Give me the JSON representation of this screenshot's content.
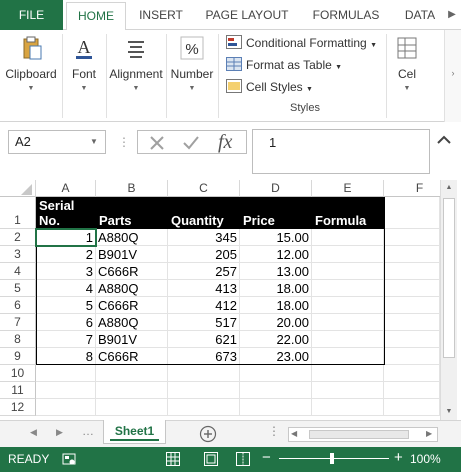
{
  "ribbon_tabs": {
    "file": "FILE",
    "home": "HOME",
    "insert": "INSERT",
    "page_layout": "PAGE LAYOUT",
    "formulas": "FORMULAS",
    "data": "DATA"
  },
  "ribbon": {
    "clipboard": "Clipboard",
    "font": "Font",
    "alignment": "Alignment",
    "number": "Number",
    "conditional_formatting": "Conditional Formatting",
    "format_as_table": "Format as Table",
    "cell_styles": "Cell Styles",
    "styles_group": "Styles",
    "cells_partial": "Cel"
  },
  "formula_bar": {
    "name_box": "A2",
    "formula": "1",
    "fx": "fx"
  },
  "grid": {
    "columns": [
      "A",
      "B",
      "C",
      "D",
      "E",
      "F"
    ],
    "rows": [
      "1",
      "2",
      "3",
      "4",
      "5",
      "6",
      "7",
      "8",
      "9",
      "10",
      "11",
      "12"
    ],
    "header": {
      "a_line1": "Serial",
      "a_line2": "No.",
      "b": "Parts",
      "c": "Quantity",
      "d": "Price",
      "e": "Formula"
    },
    "data": [
      [
        "1",
        "A880Q",
        "345",
        "15.00"
      ],
      [
        "2",
        "B901V",
        "205",
        "12.00"
      ],
      [
        "3",
        "C666R",
        "257",
        "13.00"
      ],
      [
        "4",
        "A880Q",
        "413",
        "18.00"
      ],
      [
        "5",
        "C666R",
        "412",
        "18.00"
      ],
      [
        "6",
        "A880Q",
        "517",
        "20.00"
      ],
      [
        "7",
        "B901V",
        "621",
        "22.00"
      ],
      [
        "8",
        "C666R",
        "673",
        "23.00"
      ]
    ]
  },
  "sheets": {
    "active": "Sheet1"
  },
  "status": {
    "ready": "READY",
    "zoom_minus": "−",
    "zoom_plus": "+",
    "zoom": "100%"
  },
  "colors": {
    "accent": "#217346",
    "header_fill": "#000000"
  }
}
